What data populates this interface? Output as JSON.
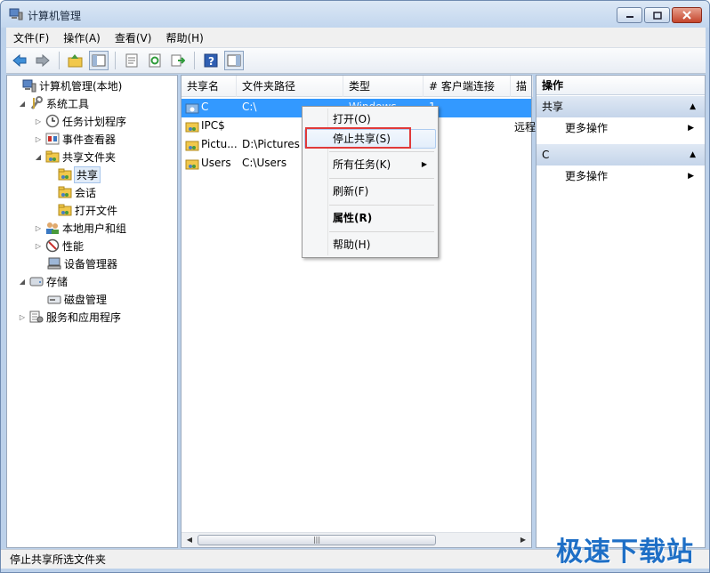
{
  "window": {
    "title": "计算机管理",
    "icon": "computer-management-icon"
  },
  "menubar": [
    {
      "label": "文件(F)"
    },
    {
      "label": "操作(A)"
    },
    {
      "label": "查看(V)"
    },
    {
      "label": "帮助(H)"
    }
  ],
  "toolbar": [
    "back-icon",
    "forward-icon",
    "up-icon",
    "show-hide-tree-icon",
    "properties-icon",
    "refresh-icon",
    "export-list-icon",
    "help-icon",
    "show-hide-action-pane-icon"
  ],
  "tree": [
    {
      "label": "计算机管理(本地)",
      "icon": "computer-management-icon"
    },
    {
      "label": "系统工具",
      "icon": "tools-icon"
    },
    {
      "label": "任务计划程序",
      "icon": "clock-icon"
    },
    {
      "label": "事件查看器",
      "icon": "event-viewer-icon"
    },
    {
      "label": "共享文件夹",
      "icon": "shared-folder-icon"
    },
    {
      "label": "共享",
      "icon": "shared-folder-icon"
    },
    {
      "label": "会话",
      "icon": "shared-folder-icon"
    },
    {
      "label": "打开文件",
      "icon": "shared-folder-icon"
    },
    {
      "label": "本地用户和组",
      "icon": "users-icon"
    },
    {
      "label": "性能",
      "icon": "performance-icon"
    },
    {
      "label": "设备管理器",
      "icon": "device-manager-icon"
    },
    {
      "label": "存储",
      "icon": "storage-icon"
    },
    {
      "label": "磁盘管理",
      "icon": "disk-icon"
    },
    {
      "label": "服务和应用程序",
      "icon": "services-icon"
    }
  ],
  "list": {
    "columns": [
      "共享名",
      "文件夹路径",
      "类型",
      "# 客户端连接",
      "描述"
    ],
    "rows": [
      {
        "name": "C",
        "path": "C:\\",
        "type": "Windows",
        "clients": "1",
        "desc": ""
      },
      {
        "name": "IPC$",
        "path": "",
        "type": "",
        "clients": "",
        "desc": "远程"
      },
      {
        "name": "Pictu...",
        "path": "D:\\Pictures",
        "type": "",
        "clients": "",
        "desc": ""
      },
      {
        "name": "Users",
        "path": "C:\\Users",
        "type": "",
        "clients": "",
        "desc": ""
      }
    ]
  },
  "context_menu": {
    "items": [
      {
        "label": "打开(O)"
      },
      {
        "label": "停止共享(S)"
      },
      {
        "label": "所有任务(K)"
      },
      {
        "label": "刷新(F)"
      },
      {
        "label": "属性(R)"
      },
      {
        "label": "帮助(H)"
      }
    ]
  },
  "action_pane": {
    "title": "操作",
    "sections": [
      {
        "title": "共享",
        "item": "更多操作"
      },
      {
        "title": "C",
        "item": "更多操作"
      }
    ]
  },
  "status": {
    "text": "停止共享所选文件夹"
  },
  "watermark": "极速下载站"
}
